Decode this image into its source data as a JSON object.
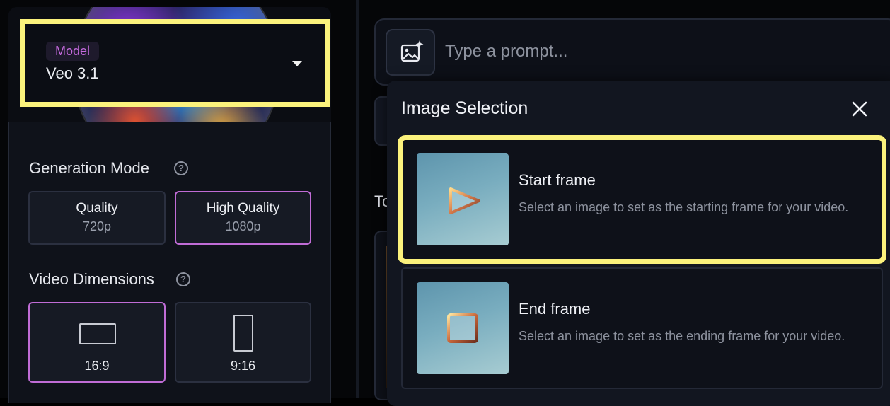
{
  "model": {
    "tag": "Model",
    "value": "Veo 3.1"
  },
  "generation_mode": {
    "title": "Generation Mode",
    "help_icon": "?",
    "options": [
      {
        "label": "Quality",
        "sub": "720p",
        "selected": false
      },
      {
        "label": "High Quality",
        "sub": "1080p",
        "selected": true
      }
    ]
  },
  "video_dimensions": {
    "title": "Video Dimensions",
    "help_icon": "?",
    "options": [
      {
        "label": "16:9",
        "selected": true
      },
      {
        "label": "9:16",
        "selected": false
      }
    ]
  },
  "prompt": {
    "placeholder": "Type a prompt...",
    "image_button_icon": "image-sparkle-icon"
  },
  "background": {
    "partial_text": "To"
  },
  "image_selection": {
    "title": "Image Selection",
    "close_icon": "close-icon",
    "frames": [
      {
        "title": "Start frame",
        "description": "Select an image to set as the starting frame for your video.",
        "icon": "play-icon",
        "highlighted": true
      },
      {
        "title": "End frame",
        "description": "Select an image to set as the ending frame for your video.",
        "icon": "stop-square-icon",
        "highlighted": false
      }
    ]
  },
  "colors": {
    "highlight": "#fbf27c",
    "accent_purple": "#c06cd6",
    "model_tag_text": "#c76be0",
    "panel_bg": "#0f121a"
  }
}
